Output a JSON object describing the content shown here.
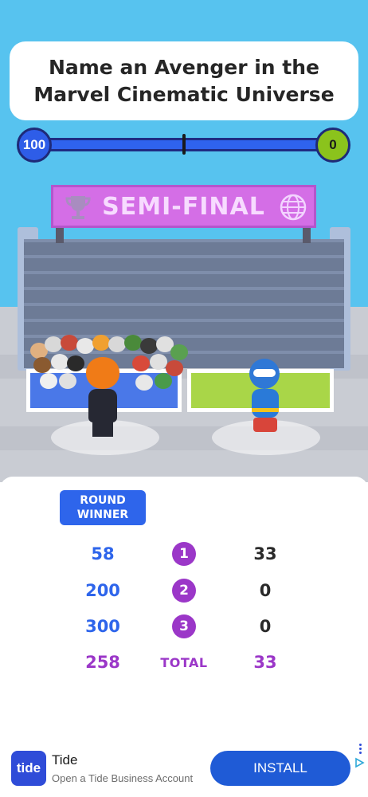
{
  "question": {
    "line1": "Name an Avenger in the",
    "line2": "Marvel Cinematic Universe"
  },
  "progress": {
    "left_score": "100",
    "right_score": "0",
    "fill_fraction": 0.98
  },
  "banner": {
    "label": "SEMI-FINAL",
    "left_icon": "trophy-icon",
    "right_icon": "globe-icon"
  },
  "results": {
    "round_winner_line1": "ROUND",
    "round_winner_line2": "WINNER",
    "rows": [
      {
        "left": "58",
        "round": "1",
        "right": "33"
      },
      {
        "left": "200",
        "round": "2",
        "right": "0"
      },
      {
        "left": "300",
        "round": "3",
        "right": "0"
      }
    ],
    "total": {
      "left": "258",
      "label": "TOTAL",
      "right": "33"
    }
  },
  "ad": {
    "logo_text": "tide",
    "title": "Tide",
    "subtitle": "Open a Tide Business Account",
    "install_label": "INSTALL"
  },
  "colors": {
    "sky": "#57c3ef",
    "player_blue": "#2e65eb",
    "opponent_green": "#8bc31c",
    "banner_purple": "#d46ee6",
    "total_purple": "#9b37c8"
  }
}
